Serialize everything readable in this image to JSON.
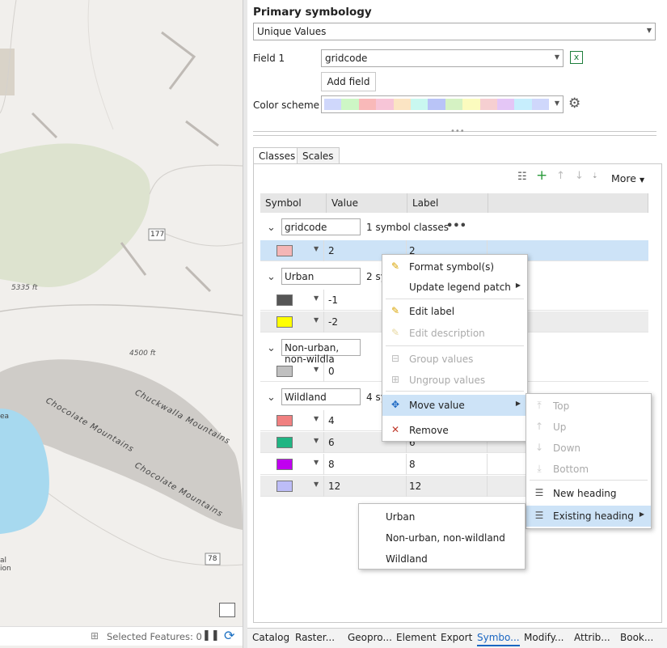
{
  "map": {
    "labels": {
      "elev1": "5335 ft",
      "elev2": "4500 ft",
      "road177": "177",
      "road78": "78",
      "mtn1": "Chuckwalla Mountains",
      "mtn2": "Chocolate Mountains",
      "mtn3": "Chocolate Mountains",
      "edge1": "ea",
      "edge2": "al",
      "edge3": "ion"
    },
    "status": {
      "selected": "Selected Features: 0"
    }
  },
  "symbology": {
    "title": "Primary symbology",
    "method": "Unique Values",
    "field_label": "Field 1",
    "field_value": "gridcode",
    "add_field": "Add field",
    "color_scheme_label": "Color scheme",
    "color_scheme": [
      "#cfd7fb",
      "#cdf6c5",
      "#f9b9b9",
      "#f7c5d7",
      "#fbe4c3",
      "#c9f8f0",
      "#b9c4f7",
      "#d5f2c3",
      "#fbfbbe",
      "#f6cfd1",
      "#e4c6f6",
      "#c7eefd",
      "#cfd7fb"
    ]
  },
  "tabs": {
    "classes": "Classes",
    "scales": "Scales"
  },
  "toolbar": {
    "more": "More"
  },
  "table": {
    "columns": [
      "Symbol",
      "Value",
      "Label"
    ],
    "groups": [
      {
        "heading": "gridcode",
        "count": "1 symbol classes",
        "rows": [
          {
            "value": "2",
            "label": "2",
            "color": "#f4b6b6"
          }
        ]
      },
      {
        "heading": "Urban",
        "count": "2 sy",
        "rows": [
          {
            "value": "-1",
            "label": "",
            "color": "#555555"
          },
          {
            "value": "-2",
            "label": "",
            "color": "#ffff00"
          }
        ]
      },
      {
        "heading": "Non-urban, non-wildla",
        "count": "",
        "rows": [
          {
            "value": "0",
            "label": "",
            "color": "#c0c0c0"
          }
        ]
      },
      {
        "heading": "Wildland",
        "count": "4 sy",
        "rows": [
          {
            "value": "4",
            "label": "",
            "color": "#f08080"
          },
          {
            "value": "6",
            "label": "6",
            "color": "#20b583"
          },
          {
            "value": "8",
            "label": "8",
            "color": "#c000f0"
          },
          {
            "value": "12",
            "label": "12",
            "color": "#bdbdf7"
          }
        ]
      }
    ]
  },
  "context_menu": {
    "items": [
      {
        "label": "Format symbol(s)",
        "icon": "pencil-icon",
        "disabled": false
      },
      {
        "label": "Update legend patch",
        "icon": "",
        "disabled": false,
        "submenu": true
      },
      {
        "label": "Edit label",
        "icon": "pencil-icon",
        "disabled": false
      },
      {
        "label": "Edit description",
        "icon": "pencil-icon",
        "disabled": true
      },
      {
        "label": "Group values",
        "icon": "group-icon",
        "disabled": true
      },
      {
        "label": "Ungroup values",
        "icon": "ungroup-icon",
        "disabled": true
      },
      {
        "label": "Move value",
        "icon": "move-icon",
        "disabled": false,
        "submenu": true
      },
      {
        "label": "Remove",
        "icon": "remove-icon",
        "disabled": false
      }
    ]
  },
  "move_menu": {
    "items": [
      {
        "label": "Top",
        "disabled": true
      },
      {
        "label": "Up",
        "disabled": true
      },
      {
        "label": "Down",
        "disabled": true
      },
      {
        "label": "Bottom",
        "disabled": true
      },
      {
        "label": "New heading",
        "disabled": false
      },
      {
        "label": "Existing heading",
        "disabled": false,
        "submenu": true
      }
    ]
  },
  "heading_menu": {
    "items": [
      "Urban",
      "Non-urban, non-wildland",
      "Wildland"
    ]
  },
  "bottom_tabs": [
    "Catalog",
    "Raster...",
    "Geopro...",
    "Element",
    "Export",
    "Symbo...",
    "Modify...",
    "Attrib...",
    "Book..."
  ]
}
